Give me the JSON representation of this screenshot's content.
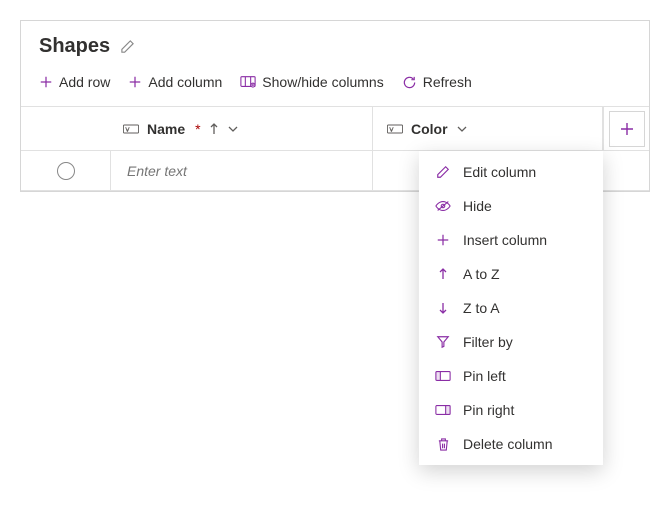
{
  "header": {
    "title": "Shapes"
  },
  "toolbar": {
    "add_row": "Add row",
    "add_column": "Add column",
    "show_hide": "Show/hide columns",
    "refresh": "Refresh"
  },
  "columns": {
    "name": {
      "label": "Name",
      "required": "*",
      "type_icon": "text"
    },
    "color": {
      "label": "Color",
      "type_icon": "text"
    }
  },
  "row0": {
    "name_placeholder": "Enter text"
  },
  "column_menu": {
    "edit": "Edit column",
    "hide": "Hide",
    "insert": "Insert column",
    "atoz": "A to Z",
    "ztoa": "Z to A",
    "filter": "Filter by",
    "pin_left": "Pin left",
    "pin_right": "Pin right",
    "delete": "Delete column"
  },
  "colors": {
    "accent": "#8a2da5"
  }
}
